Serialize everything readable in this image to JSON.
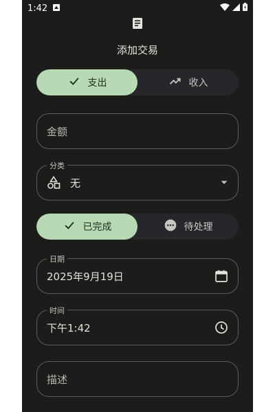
{
  "status": {
    "time": "1:42"
  },
  "header": {
    "title": "添加交易"
  },
  "type_toggle": {
    "expense_label": "支出",
    "income_label": "收入",
    "selected": "expense"
  },
  "amount": {
    "placeholder": "金额"
  },
  "category": {
    "label": "分类",
    "value": "无"
  },
  "status_toggle": {
    "completed_label": "已完成",
    "pending_label": "待处理",
    "selected": "completed"
  },
  "date": {
    "label": "日期",
    "value": "2025年9月19日"
  },
  "time": {
    "label": "时间",
    "value": "下午1:42"
  },
  "description": {
    "placeholder": "描述"
  },
  "colors": {
    "accent": "#b7d9b4",
    "background": "#1c1c1a",
    "outline": "#5d5f59"
  }
}
